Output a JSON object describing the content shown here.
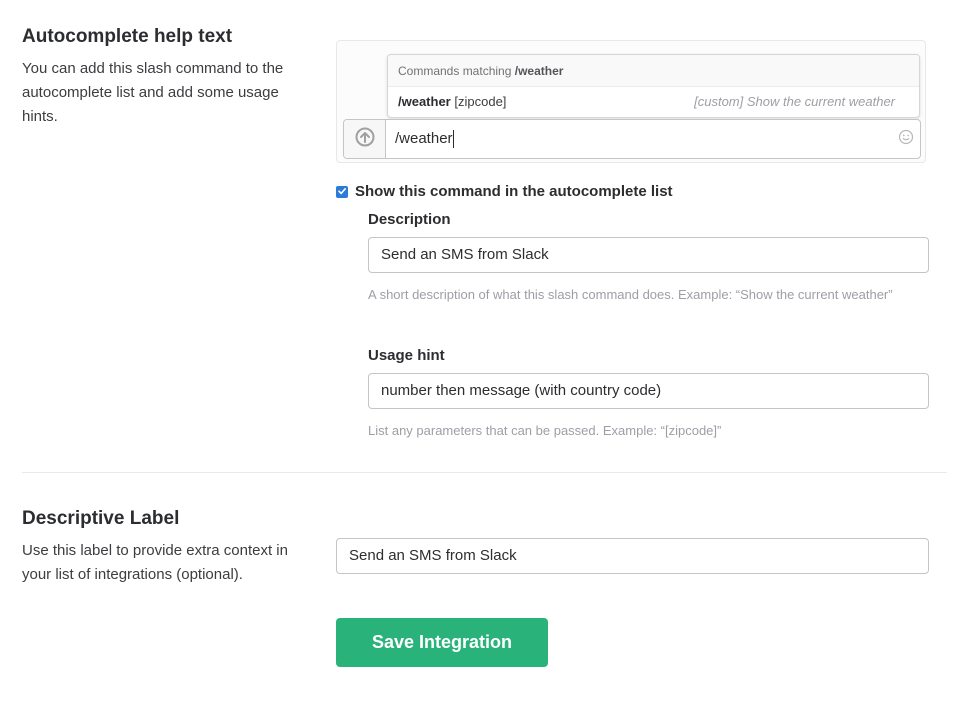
{
  "autocomplete": {
    "title": "Autocomplete help text",
    "description": "You can add this slash command to the autocomplete list and add some usage hints."
  },
  "preview": {
    "header_prefix": "Commands matching",
    "header_command": "/weather",
    "row_command": "/weather",
    "row_hint": "[zipcode]",
    "row_custom": "[custom] Show the current weather",
    "input_value": "/weather"
  },
  "show_in_list": {
    "label": "Show this command in the autocomplete list",
    "checked": true
  },
  "description_field": {
    "label": "Description",
    "value": "Send an SMS from Slack",
    "help": "A short description of what this slash command does. Example: “Show the current weather”"
  },
  "usage_hint_field": {
    "label": "Usage hint",
    "value": "number then message (with country code)",
    "help": "List any parameters that can be passed. Example: “[zipcode]”"
  },
  "descriptive_label": {
    "title": "Descriptive Label",
    "description": "Use this label to provide extra context in your list of integrations (optional).",
    "value": "Send an SMS from Slack"
  },
  "save_button": {
    "label": "Save Integration"
  },
  "colors": {
    "accent_green": "#2ab27b",
    "checkbox_blue": "#2d7bd8"
  },
  "icons": {
    "upload": "upload-arrow-icon",
    "emoji": "emoji-smiley-icon",
    "checkmark": "checkmark-icon"
  }
}
